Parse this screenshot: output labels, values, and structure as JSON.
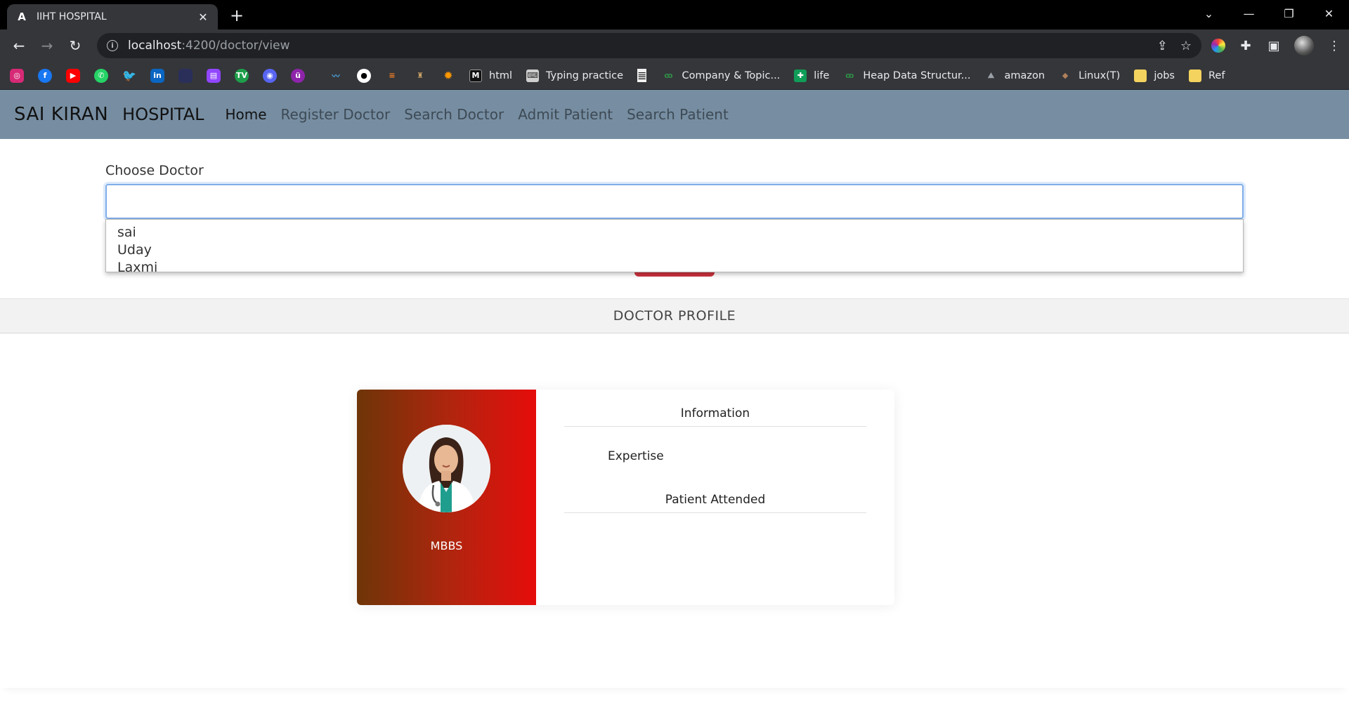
{
  "browser": {
    "tab_title": "IIHT HOSPITAL",
    "tab_favicon": "A",
    "url_host": "localhost",
    "url_path": ":4200/doctor/view",
    "icons": [
      "back-icon",
      "forward-icon",
      "reload-icon",
      "info-icon",
      "share-icon",
      "star-icon",
      "extensions-icon",
      "sidepanel-icon",
      "menu-icon"
    ],
    "bookmarks_icon_only": [
      {
        "name": "instagram",
        "color": "#d62976"
      },
      {
        "name": "facebook",
        "color": "#1877f2"
      },
      {
        "name": "youtube",
        "color": "#ff0000"
      },
      {
        "name": "whatsapp",
        "color": "#25d366"
      },
      {
        "name": "twitter",
        "color": "#1da1f2"
      },
      {
        "name": "linkedin",
        "color": "#0a66c2"
      },
      {
        "name": "blank",
        "color": "#2a2f5a"
      },
      {
        "name": "twitch",
        "color": "#9146ff"
      },
      {
        "name": "tradingview",
        "color": "#1e9e4a"
      },
      {
        "name": "discord",
        "color": "#5865f2"
      },
      {
        "name": "unknown-purple",
        "color": "#8e24aa"
      }
    ],
    "bookmarks": [
      {
        "label": "html",
        "color": "#222"
      },
      {
        "label": "Typing practice",
        "color": "#cfcfcf"
      },
      {
        "label": "Company & Topic...",
        "color": "#2f8d46"
      },
      {
        "label": "life",
        "color": "#0f9d58"
      },
      {
        "label": "Heap Data Structur...",
        "color": "#2f8d46"
      },
      {
        "label": "amazon",
        "color": "#9aa0a6"
      },
      {
        "label": "Linux(T)",
        "color": "#b0805a"
      },
      {
        "label": "jobs",
        "color": "#f4d35e"
      },
      {
        "label": "Ref",
        "color": "#f4d35e"
      }
    ]
  },
  "navbar": {
    "brand_a": "SAI KIRAN",
    "brand_b": "HOSPITAL",
    "links": [
      "Home",
      "Register Doctor",
      "Search Doctor",
      "Admit Patient",
      "Search Patient"
    ]
  },
  "choose": {
    "label": "Choose Doctor",
    "value": "",
    "options": [
      "sai",
      "Uday",
      "Laxmi"
    ]
  },
  "profile": {
    "bar_title": "DOCTOR PROFILE",
    "degree": "MBBS",
    "info_heading": "Information",
    "expertise_label": "Expertise",
    "patient_heading": "Patient Attended"
  }
}
